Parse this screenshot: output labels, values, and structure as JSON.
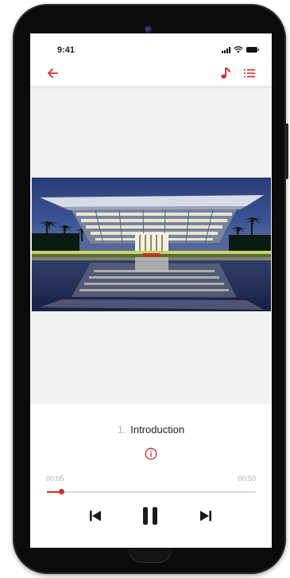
{
  "status_bar": {
    "time": "9:41",
    "icons": [
      "signal-icon",
      "wifi-icon",
      "battery-icon"
    ]
  },
  "app_bar": {
    "icons": [
      "arrow-left-icon",
      "music-note-icon",
      "playlist-icon"
    ]
  },
  "media": {
    "image_description_icon": "photo"
  },
  "player": {
    "track_number": "1.",
    "track_title": "Introduction",
    "elapsed": "00:05",
    "duration": "00:50",
    "progress": 0.07,
    "controls": [
      "previous-icon",
      "pause-icon",
      "next-icon"
    ]
  },
  "colors": {
    "accent": "#d32f2f",
    "media_background": "#f2f2f2",
    "frame": "#0b0b0b"
  }
}
